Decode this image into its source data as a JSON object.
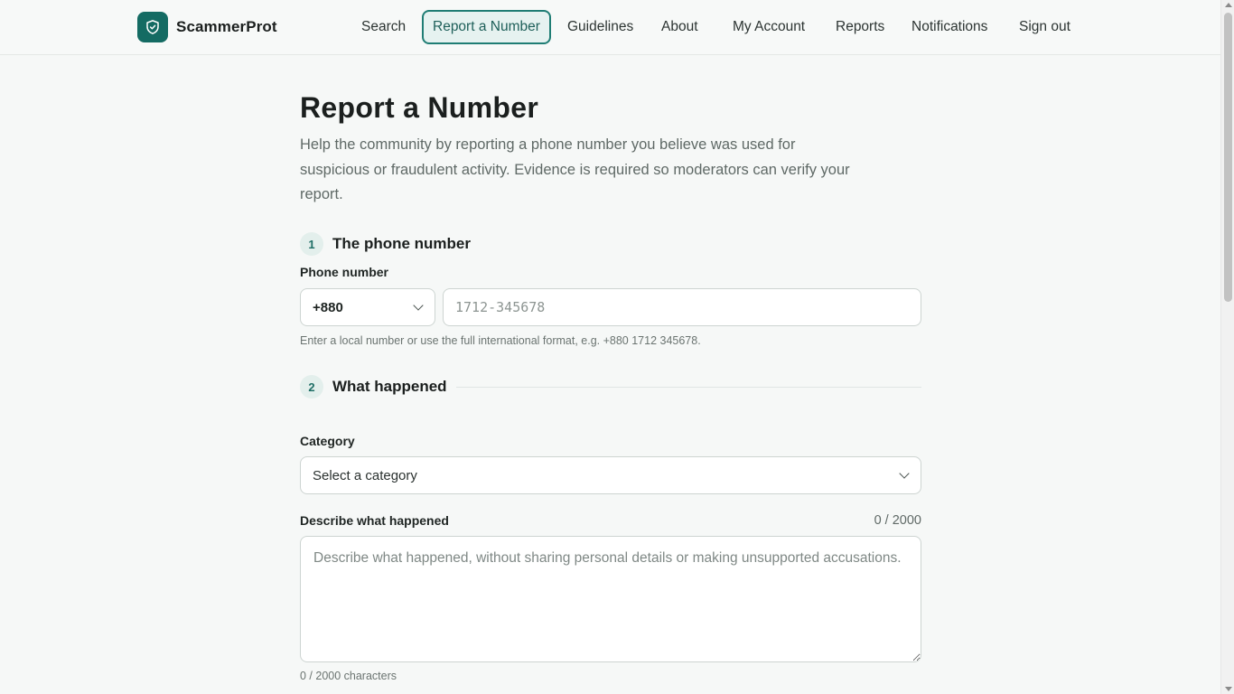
{
  "header": {
    "brand_name": "ScammerProt",
    "nav": [
      {
        "label": "Search"
      },
      {
        "label": "Report a Number",
        "active": true
      },
      {
        "label": "Guidelines"
      },
      {
        "label": "About"
      },
      {
        "label": "My Account"
      },
      {
        "label": "Reports"
      },
      {
        "label": "Notifications"
      },
      {
        "label": "Sign out"
      }
    ]
  },
  "page": {
    "title": "Report a Number",
    "intro": "Help the community by reporting a phone number you believe was used for suspicious or fraudulent activity. Evidence is required so moderators can verify your report."
  },
  "step1": {
    "number": "1",
    "title": "The phone number",
    "phone_label": "Phone number",
    "country_code": "+880",
    "phone_placeholder": "1712-345678",
    "phone_helper": "Enter a local number or use the full international format, e.g. +880 1712 345678."
  },
  "step2": {
    "number": "2",
    "title": "What happened",
    "category_label": "Category",
    "category_value": "Select a category",
    "description_label": "Describe what happened",
    "description_counter": "0 / 2000",
    "description_placeholder": "Describe what happened, without sharing personal details or making unsupported accusations.",
    "description_helper": "0 / 2000 characters"
  },
  "colors": {
    "brand": "#146b63",
    "active_nav_border": "#1f7d74",
    "background": "#f6f8f7"
  },
  "icons": {
    "logo": "shield-icon",
    "select": "chevron-down-icon"
  }
}
